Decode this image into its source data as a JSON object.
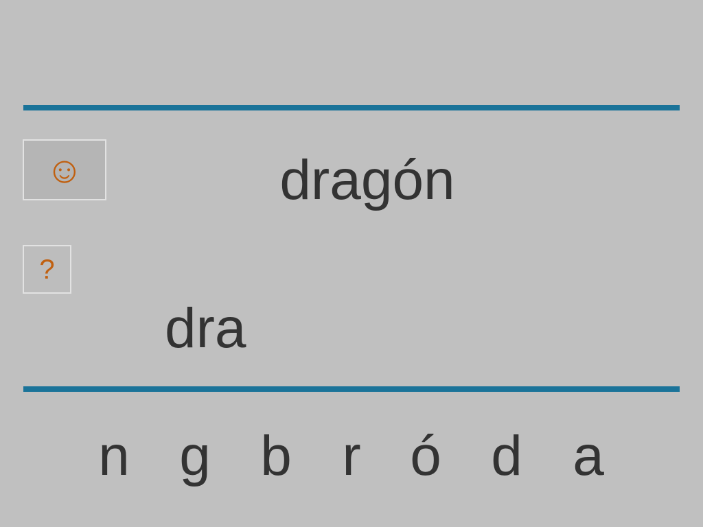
{
  "hint": {
    "smile_icon": "☺",
    "help_icon": "?"
  },
  "target_word": "dragón",
  "answer_so_far": "dra",
  "letters": [
    "n",
    "g",
    "b",
    "r",
    "ó",
    "d",
    "a"
  ],
  "colors": {
    "background": "#c0c0c0",
    "rule": "#1a7399",
    "icon": "#c06010",
    "text": "#333333"
  }
}
